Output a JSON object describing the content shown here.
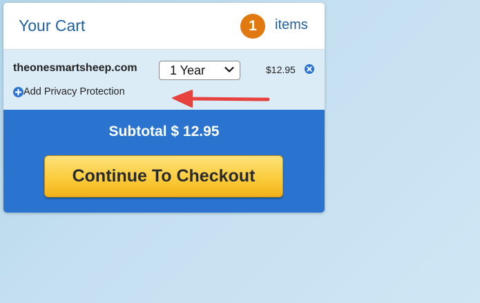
{
  "cart": {
    "title": "Your Cart",
    "item_count": "1",
    "items_label": "items"
  },
  "line_item": {
    "domain": "theonesmartsheep.com",
    "term_selected": "1 Year",
    "price": "$12.95",
    "privacy_label": "Add Privacy Protection"
  },
  "checkout": {
    "subtotal_label": "Subtotal $ 12.95",
    "button_label": "Continue To Checkout"
  },
  "colors": {
    "brand_blue": "#2a74d0",
    "title_blue": "#1f5f9e",
    "badge_orange": "#e07a10",
    "button_yellow": "#fbcc3c",
    "annotation_red": "#e8423f"
  },
  "icons": [
    "chevron-down-icon",
    "remove-circle-icon",
    "plus-circle-icon",
    "annotation-arrow"
  ]
}
